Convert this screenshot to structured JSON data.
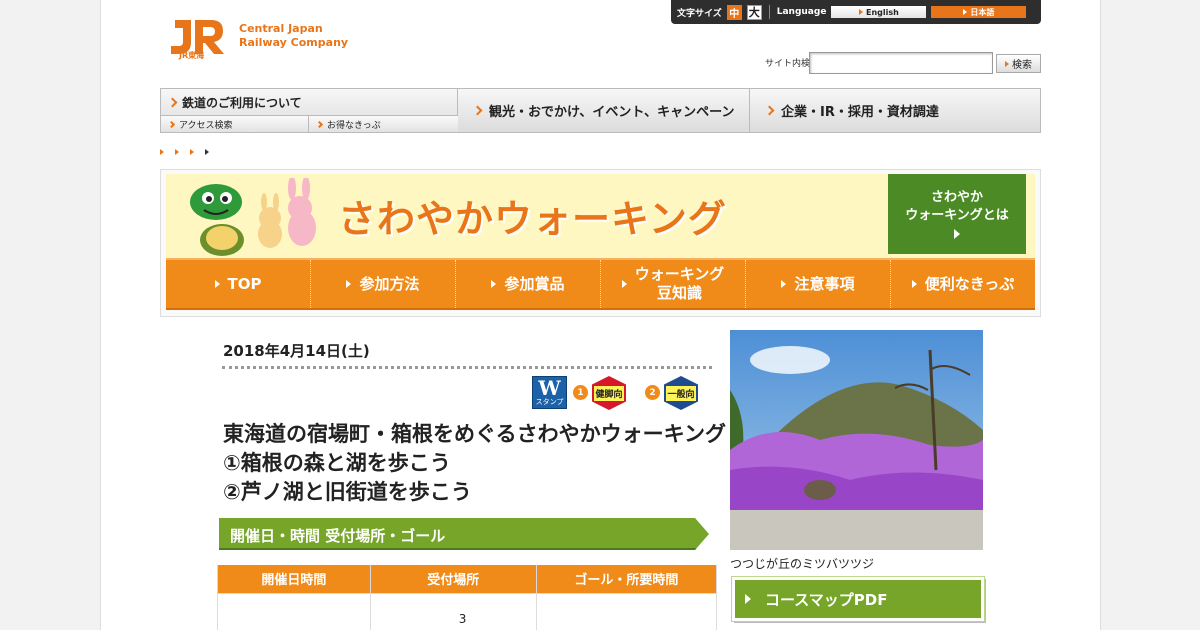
{
  "header": {
    "logo_jr": "JR",
    "logo_line1": "Central Japan",
    "logo_line2": "Railway Company",
    "logo_sub": "JR東海",
    "font_size_label": "文字サイズ",
    "font_size_mid": "中",
    "font_size_large": "大",
    "language_label": "Language",
    "lang_en": "English",
    "lang_jp": "日本語",
    "search_label": "サイト内検索",
    "search_value": "",
    "search_button": "検索"
  },
  "global_nav": {
    "main": "鉄道のご利用について",
    "sub1": "アクセス検索",
    "sub2": "お得なきっぷ",
    "item2": "観光・おでかけ、イベント、キャンペーン",
    "item3": "企業・IR・採用・資材調達"
  },
  "banner": {
    "title": "さわやかウォーキング",
    "side_line1": "さわやか",
    "side_line2": "ウォーキングとは",
    "nav": [
      "TOP",
      "参加方法",
      "参加賞品",
      "ウォーキング\n豆知識",
      "注意事項",
      "便利なきっぷ"
    ]
  },
  "event": {
    "date": "2018年4月14日(土)",
    "badge_w": "W",
    "badge_w_sub": "スタンプ",
    "course1_num": "1",
    "course1_badge": "健脚向",
    "course2_num": "2",
    "course2_badge": "一般向",
    "title_line1": "東海道の宿場町・箱根をめぐるさわやかウォーキング",
    "title_line2": "①箱根の森と湖を歩こう",
    "title_line3": "②芦ノ湖と旧街道を歩こう",
    "section_title": "開催日・時間 受付場所・ゴール",
    "table_headers": [
      "開催日時間",
      "受付場所",
      "ゴール・所要時間"
    ],
    "table_row": [
      "",
      "3",
      ""
    ]
  },
  "sidebar": {
    "photo_caption": "つつじが丘のミツバツツジ",
    "pdf_button": "コースマップPDF"
  },
  "colors": {
    "accent": "#e8751a",
    "green": "#76a52a",
    "banner_bg": "#fff7c2"
  }
}
